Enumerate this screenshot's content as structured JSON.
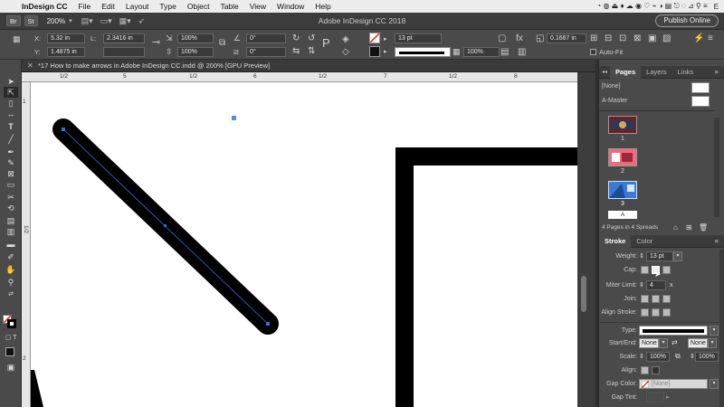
{
  "menubar": {
    "app_name": "InDesign CC",
    "items": [
      "File",
      "Edit",
      "Layout",
      "Type",
      "Object",
      "Table",
      "View",
      "Window",
      "Help"
    ],
    "right_last": "E"
  },
  "appbar": {
    "br_label": "Br",
    "st_label": "St",
    "zoom": "200%",
    "title": "Adobe InDesign CC 2018",
    "publish_label": "Publish Online"
  },
  "control": {
    "x_label": "X:",
    "x_value": "5.32 in",
    "y_label": "Y:",
    "y_value": "1.4875 in",
    "w_label": "L:",
    "w_value": "2.3416 in",
    "scale_x": "100%",
    "scale_y": "100%",
    "angle": "0°",
    "shear": "0°",
    "stroke_weight": "13 pt",
    "opacity": "100%",
    "offset": "0.1667 in",
    "autofit_label": "Auto-Fit"
  },
  "document_tab": {
    "title": "*17 How to make arrows in Adobe InDesign CC.indd @ 200% [GPU Preview]"
  },
  "ruler": {
    "h_labels": [
      "1/2",
      "5",
      "1/2",
      "6",
      "1/2",
      "7",
      "1/2",
      "8"
    ],
    "v_labels": [
      "1",
      "1/2",
      "2"
    ]
  },
  "pages_panel": {
    "tabs": [
      "Pages",
      "Layers",
      "Links"
    ],
    "none_label": "[None]",
    "master_label": "A-Master",
    "page_numbers": [
      "1",
      "2",
      "3"
    ],
    "current_master_letter": "A",
    "status": "4 Pages in 4 Spreads"
  },
  "stroke_panel": {
    "tabs": [
      "Stroke",
      "Color"
    ],
    "weight_label": "Weight:",
    "weight_value": "13 pt",
    "cap_label": "Cap:",
    "miter_label": "Miter Limit:",
    "miter_value": "4",
    "miter_unit": "x",
    "join_label": "Join:",
    "align_label": "Align Stroke:",
    "type_label": "Type:",
    "start_end_label": "Start/End:",
    "start_value": "None",
    "end_value": "None",
    "scale_label": "Scale:",
    "scale_start": "100%",
    "scale_end": "100%",
    "align2_label": "Align:",
    "gap_color_label": "Gap Color:",
    "gap_color_value": "[None]",
    "gap_tint_label": "Gap Tint:"
  },
  "colors": {
    "accent": "#1e7fd8",
    "selection": "#3b6fd6",
    "stroke": "#000000"
  }
}
